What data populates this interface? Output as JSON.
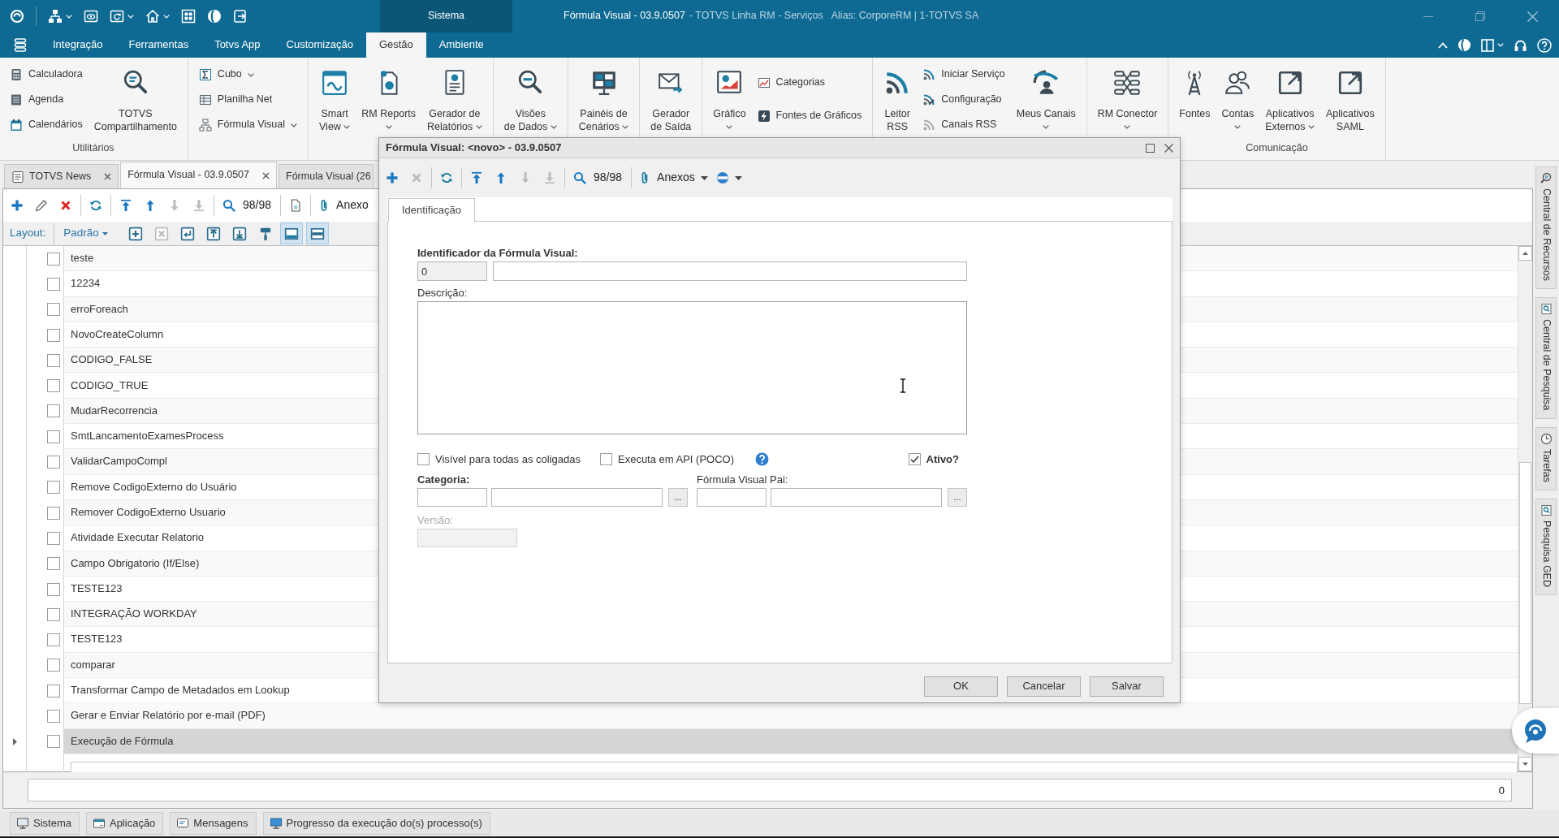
{
  "title_bar": {
    "context_tab": "Sistema",
    "title": "Fórmula Visual - 03.9.0507",
    "product": "- TOTVS Linha RM - Serviços",
    "alias": "Alias: CorporeRM | 1-TOTVS SA"
  },
  "ribbon": {
    "tabs": [
      {
        "label": "Integração",
        "selected": false
      },
      {
        "label": "Ferramentas",
        "selected": false
      },
      {
        "label": "Totvs App",
        "selected": false
      },
      {
        "label": "Customização",
        "selected": false
      },
      {
        "label": "Gestão",
        "selected": true
      },
      {
        "label": "Ambiente",
        "selected": false
      }
    ],
    "groups": [
      {
        "label": "Utilitários",
        "items": [
          {
            "kind": "small",
            "label": "Calculadora",
            "dropdown": false
          },
          {
            "kind": "small",
            "label": "Agenda",
            "dropdown": false
          },
          {
            "kind": "small",
            "label": "Calendários",
            "dropdown": false
          },
          {
            "kind": "large",
            "label": "TOTVS\nCompartilhamento",
            "dropdown": false
          }
        ]
      },
      {
        "items": [
          {
            "kind": "small",
            "label": "Cubo",
            "dropdown": true
          },
          {
            "kind": "small",
            "label": "Planilha Net",
            "dropdown": false
          },
          {
            "kind": "small",
            "label": "Fórmula Visual",
            "dropdown": true
          }
        ]
      },
      {
        "items": [
          {
            "kind": "large",
            "label": "Smart\nView",
            "dropdown": true
          },
          {
            "kind": "large",
            "label": "RM Reports",
            "dropdown": true
          },
          {
            "kind": "large",
            "label": "Gerador de\nRelatórios",
            "dropdown": true
          }
        ]
      },
      {
        "items": [
          {
            "kind": "large",
            "label": "Visões\nde Dados",
            "dropdown": true
          }
        ]
      },
      {
        "items": [
          {
            "kind": "large",
            "label": "Painéis de\nCenários",
            "dropdown": true
          }
        ]
      },
      {
        "items": [
          {
            "kind": "large",
            "label": "Gerador\nde Saída",
            "dropdown": false
          }
        ]
      },
      {
        "items": [
          {
            "kind": "large",
            "label": "Gráfico",
            "dropdown": true
          },
          {
            "kind": "small",
            "label": "Categorias",
            "dropdown": false
          },
          {
            "kind": "small",
            "label": "Fontes de Gráficos",
            "dropdown": false
          }
        ]
      },
      {
        "items": [
          {
            "kind": "large",
            "label": "Leitor\nRSS",
            "dropdown": false
          },
          {
            "kind": "small",
            "label": "Iniciar Serviço",
            "dropdown": false
          },
          {
            "kind": "small",
            "label": "Configuração",
            "dropdown": false
          },
          {
            "kind": "small",
            "label": "Canais RSS",
            "dropdown": false
          },
          {
            "kind": "large",
            "label": "Meus Canais",
            "dropdown": true
          }
        ]
      },
      {
        "items": [
          {
            "kind": "large",
            "label": "RM Conector",
            "dropdown": true
          }
        ]
      },
      {
        "label": "Comunicação",
        "items": [
          {
            "kind": "large",
            "label": "Fontes",
            "dropdown": false
          },
          {
            "kind": "large",
            "label": "Contas",
            "dropdown": true
          },
          {
            "kind": "large",
            "label": "Aplicativos\nExternos",
            "dropdown": true
          },
          {
            "kind": "large",
            "label": "Aplicativos\nSAML",
            "dropdown": false
          }
        ]
      }
    ]
  },
  "document_tabs": [
    {
      "label": "TOTVS News",
      "selected": false,
      "closable": true
    },
    {
      "label": "Fórmula Visual - 03.9.0507",
      "selected": true,
      "closable": true
    },
    {
      "label": "Fórmula Visual (26",
      "selected": false,
      "closable": false
    }
  ],
  "toolbar": {
    "groups": [
      {
        "buttons": [
          {
            "kind": "add",
            "disabled": false
          },
          {
            "kind": "edit",
            "disabled": false
          },
          {
            "kind": "delete",
            "disabled": false
          }
        ]
      },
      {
        "buttons": [
          {
            "kind": "refresh",
            "disabled": false
          }
        ]
      },
      {
        "buttons": [
          {
            "kind": "first",
            "disabled": false
          },
          {
            "kind": "previous",
            "disabled": false
          },
          {
            "kind": "next",
            "disabled": true
          },
          {
            "kind": "last",
            "disabled": true
          }
        ]
      },
      {
        "buttons": [
          {
            "kind": "search",
            "disabled": false
          },
          {
            "kind": "counter",
            "label": "98/98"
          }
        ]
      },
      {
        "buttons": [
          {
            "kind": "report",
            "disabled": false
          }
        ]
      },
      {
        "buttons": [
          {
            "kind": "attach",
            "label": "Anexo",
            "disabled": false,
            "dropdown": false
          }
        ]
      }
    ]
  },
  "layout_bar": {
    "label": "Layout:",
    "preset": "Padrão",
    "tools": [
      {
        "kind": "new",
        "disabled": false,
        "selected": false
      },
      {
        "kind": "remove",
        "disabled": true,
        "selected": false
      },
      {
        "kind": "apply",
        "disabled": false,
        "selected": false
      },
      {
        "kind": "upload",
        "disabled": false,
        "selected": false
      },
      {
        "kind": "download",
        "disabled": false,
        "selected": false
      },
      {
        "kind": "paint",
        "disabled": false,
        "selected": false
      },
      {
        "kind": "panel_bottom",
        "disabled": false,
        "selected": true
      },
      {
        "kind": "panel_split",
        "disabled": false,
        "selected": true
      }
    ]
  },
  "grid": {
    "rows": [
      {
        "label": "teste",
        "checked": false,
        "selected": false
      },
      {
        "label": "12234",
        "checked": false,
        "selected": false
      },
      {
        "label": "erroForeach",
        "checked": false,
        "selected": false
      },
      {
        "label": "NovoCreateColumn",
        "checked": false,
        "selected": false
      },
      {
        "label": "CODIGO_FALSE",
        "checked": false,
        "selected": false
      },
      {
        "label": "CODIGO_TRUE",
        "checked": false,
        "selected": false
      },
      {
        "label": "MudarRecorrencia",
        "checked": false,
        "selected": false
      },
      {
        "label": "SmtLancamentoExamesProcess",
        "checked": false,
        "selected": false
      },
      {
        "label": "ValidarCampoCompl",
        "checked": false,
        "selected": false
      },
      {
        "label": "Remove CodigoExterno do Usuário",
        "checked": false,
        "selected": false
      },
      {
        "label": "Remover CodigoExterno Usuario",
        "checked": false,
        "selected": false
      },
      {
        "label": "Atividade Executar Relatorio",
        "checked": false,
        "selected": false
      },
      {
        "label": "Campo Obrigatorio (If/Else)",
        "checked": false,
        "selected": false
      },
      {
        "label": "TESTE123",
        "checked": false,
        "selected": false
      },
      {
        "label": "INTEGRAÇÃO WORKDAY",
        "checked": false,
        "selected": false
      },
      {
        "label": "TESTE123",
        "checked": false,
        "selected": false
      },
      {
        "label": "comparar",
        "checked": false,
        "selected": false
      },
      {
        "label": "Transformar Campo de Metadados em Lookup",
        "checked": false,
        "selected": false
      },
      {
        "label": "Gerar e Enviar Relatório por e-mail (PDF)",
        "checked": false,
        "selected": false
      },
      {
        "label": "Execução de Fórmula",
        "checked": false,
        "selected": true
      }
    ]
  },
  "status_field": {
    "value": "0"
  },
  "bottom_tabs": [
    "Sistema",
    "Aplicação",
    "Mensagens",
    "Progresso da execução do(s) processo(s)"
  ],
  "side_tabs": [
    "Central de Recursos",
    "Central de Pesquisa",
    "Tarefas",
    "Pesquisa GED"
  ],
  "dialog": {
    "title": "Fórmula Visual: <novo> - 03.9.0507",
    "toolbar": {
      "groups": [
        {
          "buttons": [
            {
              "kind": "add",
              "disabled": false
            },
            {
              "kind": "delete",
              "disabled": true
            }
          ]
        },
        {
          "buttons": [
            {
              "kind": "refresh",
              "disabled": false
            }
          ]
        },
        {
          "buttons": [
            {
              "kind": "first",
              "disabled": false
            },
            {
              "kind": "previous",
              "disabled": false
            },
            {
              "kind": "next",
              "disabled": true
            },
            {
              "kind": "last",
              "disabled": true
            }
          ]
        },
        {
          "buttons": [
            {
              "kind": "search",
              "disabled": false
            },
            {
              "kind": "counter",
              "label": "98/98"
            }
          ]
        },
        {
          "buttons": [
            {
              "kind": "attach",
              "label": "Anexos",
              "disabled": false,
              "dropdown": true
            },
            {
              "kind": "links",
              "disabled": false,
              "dropdown": true
            }
          ]
        }
      ]
    },
    "tabs": [
      {
        "label": "Identificação",
        "selected": true
      }
    ],
    "identifier": {
      "label": "Identificador da Fórmula Visual:",
      "required": true,
      "value": "0"
    },
    "description": {
      "label": "Descrição:"
    },
    "options": [
      {
        "label": "Visível para todas as coligadas",
        "checked": false,
        "required": false,
        "help": false
      },
      {
        "label": "Executa em API (POCO)",
        "checked": false,
        "required": false,
        "help": true
      },
      {
        "label": "Ativo?",
        "checked": true,
        "required": true,
        "help": false
      }
    ],
    "lookups": [
      {
        "label": "Categoria:",
        "required": true,
        "button": "..."
      },
      {
        "label": "Fórmula Visual Pai:",
        "required": false,
        "button": "..."
      }
    ],
    "version": {
      "label": "Versão:",
      "disabled": true
    },
    "buttons": [
      "OK",
      "Cancelar",
      "Salvar"
    ]
  }
}
